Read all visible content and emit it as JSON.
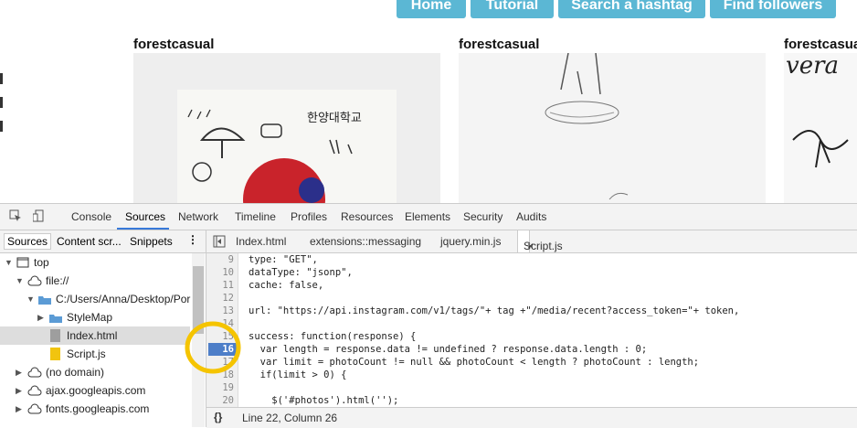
{
  "nav": {
    "home": "Home",
    "tutorial": "Tutorial",
    "search": "Search a hashtag",
    "followers": "Find followers"
  },
  "feed": {
    "usernames": [
      "forestcasual",
      "forestcasual",
      "forestcasual"
    ]
  },
  "devtools": {
    "tabs": [
      "Console",
      "Sources",
      "Network",
      "Timeline",
      "Profiles",
      "Resources",
      "Elements",
      "Security",
      "Audits"
    ],
    "active_tab": "Sources",
    "side_tabs": [
      "Sources",
      "Content scr...",
      "Snippets"
    ],
    "tree": [
      {
        "label": "top",
        "icon": "window-icon",
        "expanded": true
      },
      {
        "label": "file://",
        "icon": "cloud-icon",
        "expanded": true
      },
      {
        "label": "C:/Users/Anna/Desktop/Por",
        "icon": "folder-icon",
        "expanded": true
      },
      {
        "label": "StyleMap",
        "icon": "folder-icon",
        "expanded": false
      },
      {
        "label": "Index.html",
        "icon": "file-icon",
        "selected": true
      },
      {
        "label": "Script.js",
        "icon": "js-file-icon"
      },
      {
        "label": "(no domain)",
        "icon": "cloud-icon",
        "expanded": false
      },
      {
        "label": "ajax.googleapis.com",
        "icon": "cloud-icon",
        "expanded": false
      },
      {
        "label": "fonts.googleapis.com",
        "icon": "cloud-icon",
        "expanded": false
      }
    ],
    "file_tabs": [
      "Index.html",
      "extensions::messaging",
      "jquery.min.js",
      "Script.js"
    ],
    "active_file": "Script.js",
    "close_glyph": "×",
    "code_lines": [
      {
        "n": "9",
        "text": "type: \"GET\","
      },
      {
        "n": "10",
        "text": "dataType: \"jsonp\","
      },
      {
        "n": "11",
        "text": "cache: false,"
      },
      {
        "n": "12",
        "text": ""
      },
      {
        "n": "13",
        "text": "url: \"https://api.instagram.com/v1/tags/\"+ tag +\"/media/recent?access_token=\"+ token,"
      },
      {
        "n": "14",
        "text": ""
      },
      {
        "n": "15",
        "text": "success: function(response) {"
      },
      {
        "n": "16",
        "text": "  var length = response.data != undefined ? response.data.length : 0;"
      },
      {
        "n": "17",
        "text": "  var limit = photoCount != null && photoCount < length ? photoCount : length;"
      },
      {
        "n": "18",
        "text": "  if(limit > 0) {"
      },
      {
        "n": "19",
        "text": ""
      },
      {
        "n": "20",
        "text": "    $('#photos').html('');"
      }
    ],
    "breakpoint_line": "16",
    "status": {
      "braces": "{}",
      "position": "Line 22, Column 26"
    },
    "colors": {
      "highlight_circle": "#f5c400",
      "breakpoint": "#4d7ec8",
      "nav_button": "#5bb7d4"
    }
  }
}
